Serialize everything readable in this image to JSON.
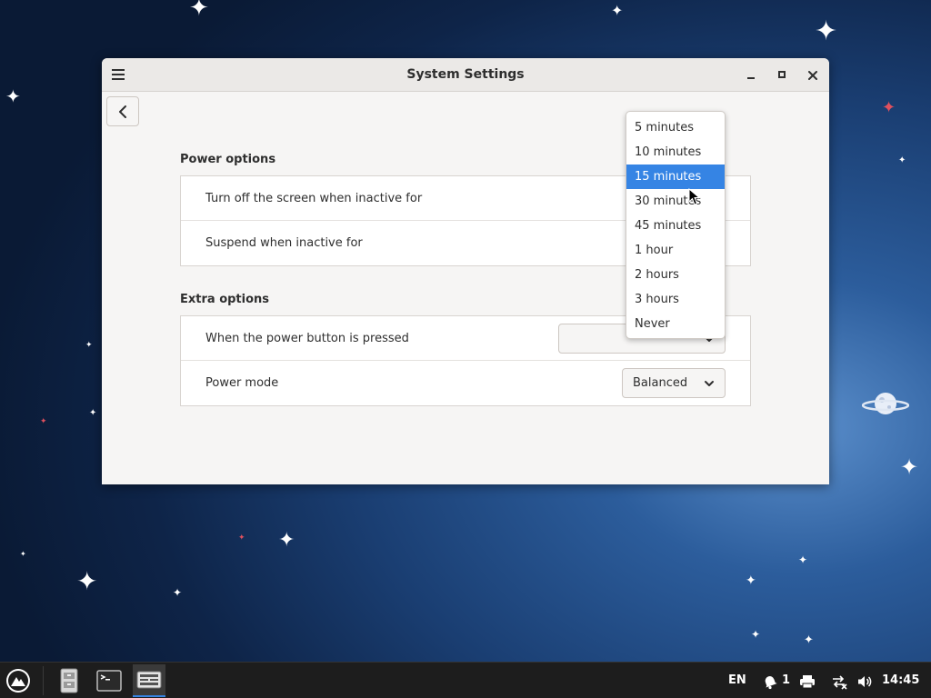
{
  "window": {
    "title": "System Settings"
  },
  "power_options": {
    "title": "Power options",
    "rows": [
      {
        "label": "Turn off the screen when inactive for"
      },
      {
        "label": "Suspend when inactive for"
      }
    ]
  },
  "extra_options": {
    "title": "Extra options",
    "rows": [
      {
        "label": "When the power button is pressed",
        "value": ""
      },
      {
        "label": "Power mode",
        "value": "Balanced"
      }
    ]
  },
  "dropdown": {
    "options": [
      "5 minutes",
      "10 minutes",
      "15 minutes",
      "30 minutes",
      "45 minutes",
      "1 hour",
      "2 hours",
      "3 hours",
      "Never"
    ],
    "selected": "15 minutes"
  },
  "taskbar": {
    "apps": [
      "file-manager-icon",
      "terminal-icon",
      "settings-app-icon"
    ],
    "active_app": "settings-app-icon",
    "keyboard_layout": "EN",
    "notification_count": "1",
    "clock": "14:45"
  },
  "colors": {
    "accent": "#3584e4",
    "taskbar_bg": "#1d1d1d",
    "window_bg": "#f6f5f4"
  }
}
